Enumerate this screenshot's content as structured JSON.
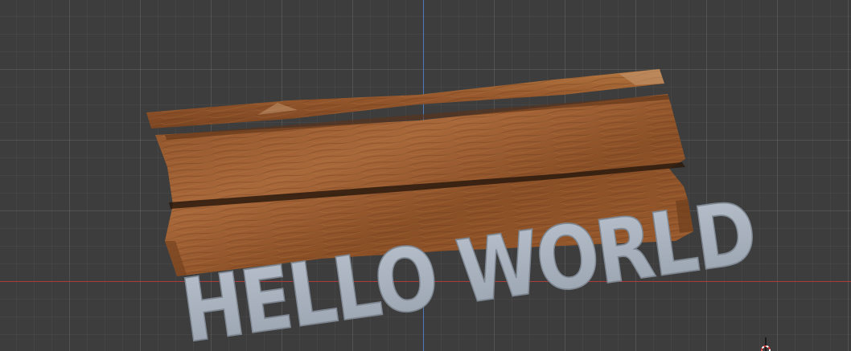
{
  "sign": {
    "text": "HELLO WORLD"
  },
  "colors": {
    "viewport_bg": "#3d3d3d",
    "axis_y": "#4e7fc9",
    "axis_x": "#b23a3a",
    "wood_dark": "#6e3e1c",
    "wood_mid": "#9a5c2e",
    "wood_light": "#b6773f",
    "text_fill": "#a9b3bf"
  },
  "icons": {
    "cursor": "3d-cursor-icon"
  }
}
